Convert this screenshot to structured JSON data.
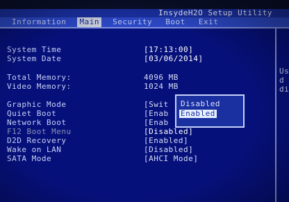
{
  "title": "InsydeH2O Setup Utility",
  "menu": {
    "tabs": [
      {
        "label": "Information"
      },
      {
        "label": "Main"
      },
      {
        "label": "Security"
      },
      {
        "label": "Boot"
      },
      {
        "label": "Exit"
      }
    ],
    "active_index": 1
  },
  "items": [
    {
      "label": "System Time",
      "value": "[17:13:00]"
    },
    {
      "label": "System Date",
      "value": "[03/06/2014]"
    },
    {
      "label": "Total Memory:",
      "value": "4096 MB"
    },
    {
      "label": "Video Memory:",
      "value": "1024 MB"
    },
    {
      "label": "Graphic Mode",
      "value": "[Swit"
    },
    {
      "label": "Quiet Boot",
      "value": "[Enab"
    },
    {
      "label": "Network Boot",
      "value": "[Enab"
    },
    {
      "label": "F12 Boot Menu",
      "value": "[Disabled]"
    },
    {
      "label": "D2D Recovery",
      "value": "[Enabled]"
    },
    {
      "label": "Wake on LAN",
      "value": "[Disabled]"
    },
    {
      "label": "SATA Mode",
      "value": "[AHCI Mode]"
    }
  ],
  "popup": {
    "options": [
      {
        "label": "Disabled"
      },
      {
        "label": "Enabled"
      }
    ],
    "selected": "Enabled"
  },
  "help": {
    "lines": [
      "Us",
      "d",
      "di"
    ]
  },
  "colors": {
    "background": "#06107a",
    "title_bar": "#1a2fa0",
    "menu_bar": "#2b47c4",
    "active_tab": "#c6ccd8",
    "text": "#c8d2f8",
    "popup_highlight": "#e7f0ff"
  }
}
